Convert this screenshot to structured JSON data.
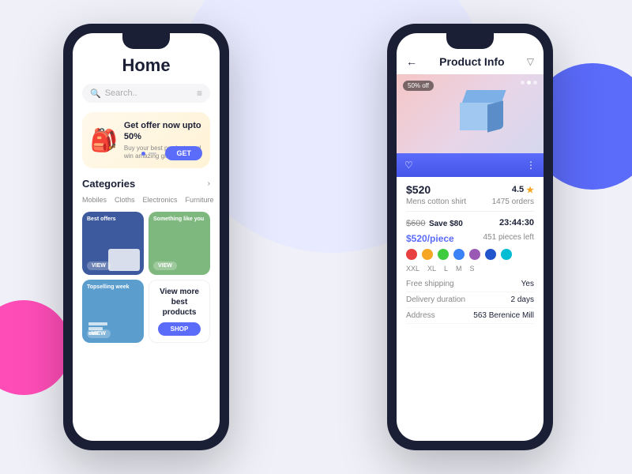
{
  "background": {
    "color": "#eceeff"
  },
  "phone1": {
    "title": "Home",
    "search": {
      "placeholder": "Search.."
    },
    "banner": {
      "headline": "Get offer now upto 50%",
      "subtext": "Buy your best products and win amazing gifts",
      "button_label": "GET"
    },
    "categories": {
      "title": "Categories",
      "tabs": [
        "Mobiles",
        "Cloths",
        "Electronics",
        "Furniture"
      ]
    },
    "products": [
      {
        "label": "Best offers",
        "view": "VIEW",
        "bg": "dark-blue"
      },
      {
        "label": "Something like you",
        "view": "VIEW",
        "bg": "green"
      },
      {
        "label": "Topselling week",
        "view": "VIEW",
        "bg": "light-blue"
      },
      {
        "view_more_line1": "View more",
        "view_more_line2": "best products",
        "shop_label": "SHOP"
      }
    ]
  },
  "phone2": {
    "title": "Product Info",
    "back_label": "←",
    "product": {
      "badge": "50% off",
      "price": "$520",
      "original_price": "$600",
      "save": "Save $80",
      "rating": "4.5",
      "name": "Mens cotton shirt",
      "orders": "1475 orders",
      "timer": "23:44:30",
      "piece_price": "$520/piece",
      "pieces_left": "451 pieces left",
      "colors": [
        "#e84040",
        "#f5a623",
        "#3ecc3e",
        "#3b82f6",
        "#9b59b6",
        "#2255cc",
        "#00bcd4"
      ],
      "sizes": [
        "XXL",
        "XL",
        "L",
        "M",
        "S"
      ],
      "free_shipping_key": "Free shipping",
      "free_shipping_val": "Yes",
      "delivery_key": "Delivery duration",
      "delivery_val": "2 days",
      "address_key": "Address",
      "address_val": "563 Berenice Mill"
    }
  }
}
